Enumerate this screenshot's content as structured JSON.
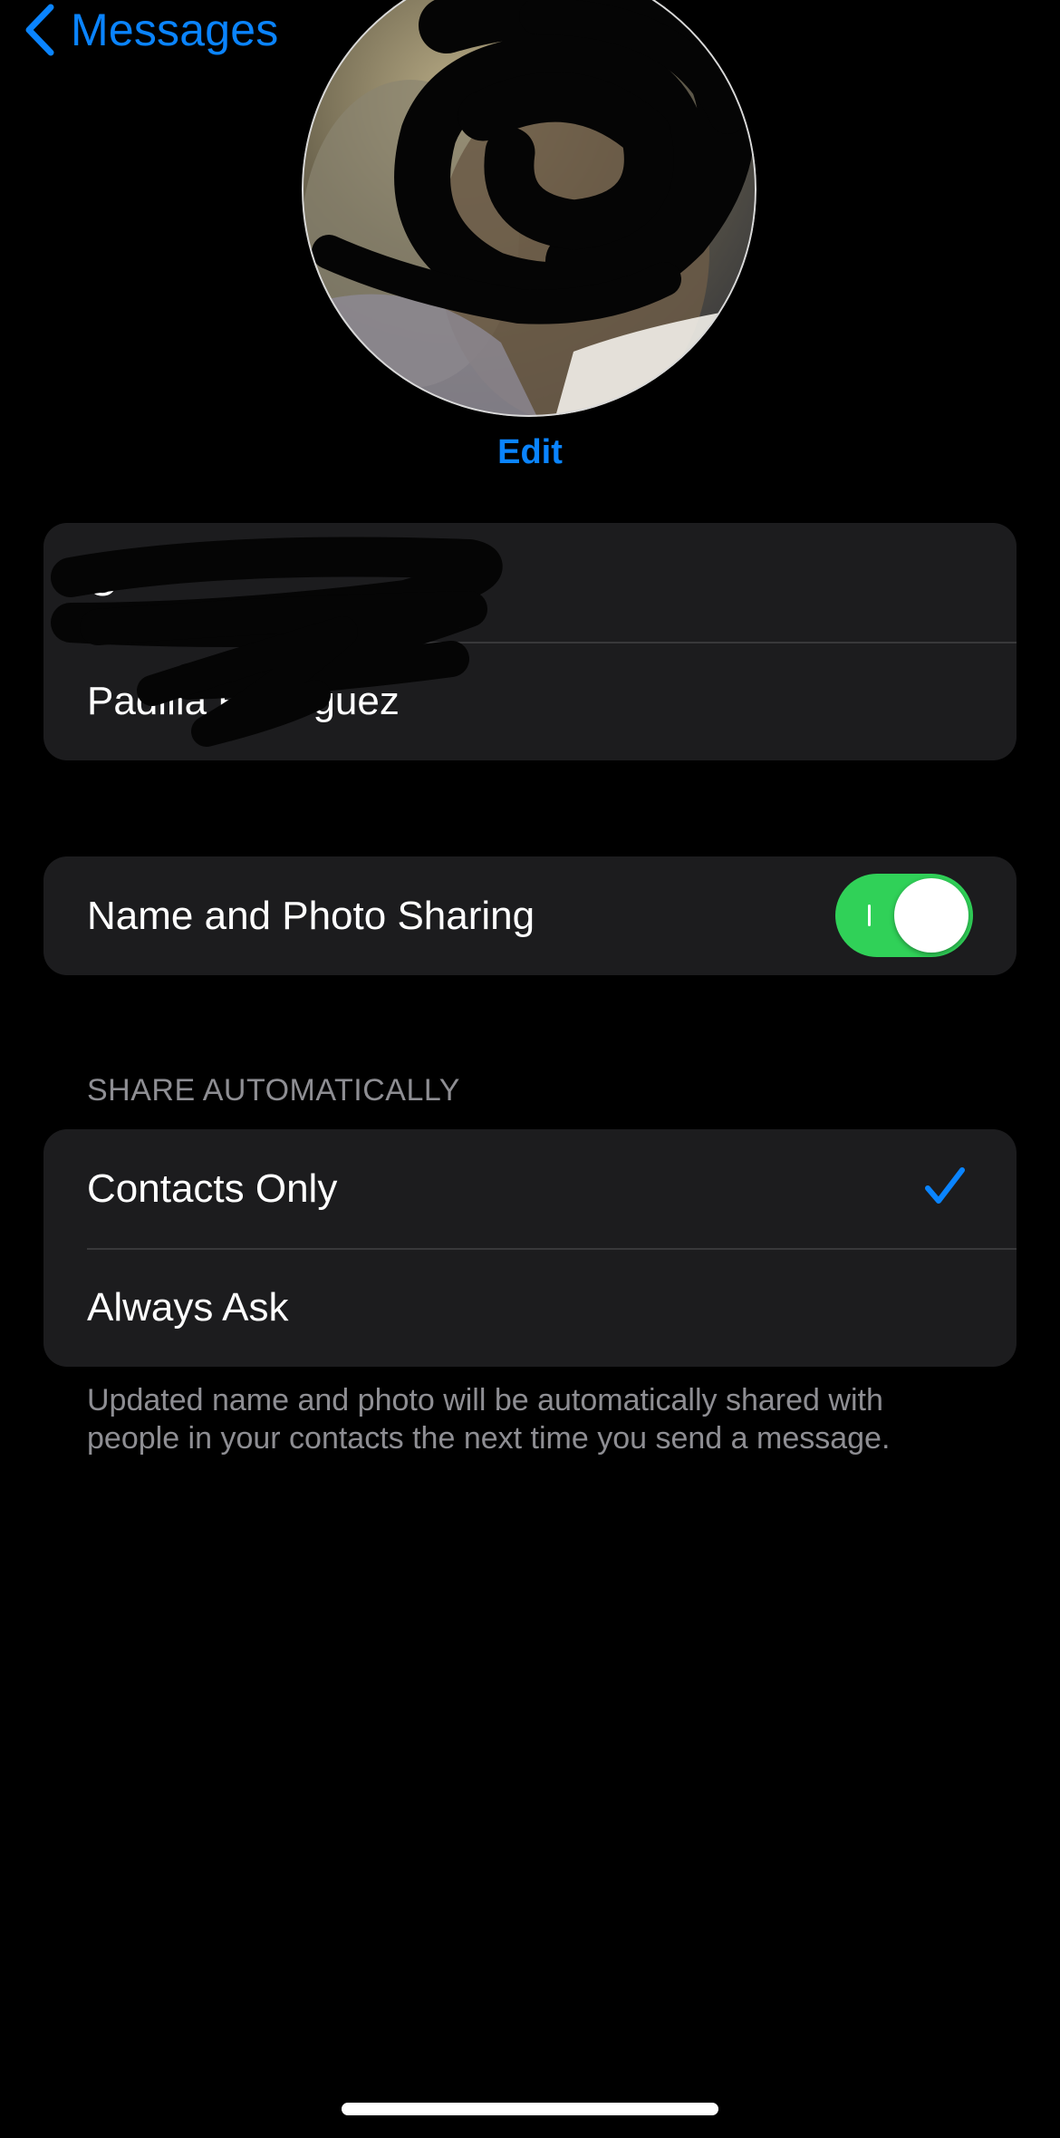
{
  "nav": {
    "back_label": "Messages"
  },
  "profile": {
    "edit_label": "Edit",
    "first_name": "O",
    "last_name": "Padilla Rodriguez"
  },
  "sharing": {
    "toggle_label": "Name and Photo Sharing",
    "toggle_on": true
  },
  "share_automatically": {
    "header": "SHARE AUTOMATICALLY",
    "options": [
      {
        "label": "Contacts Only",
        "selected": true
      },
      {
        "label": "Always Ask",
        "selected": false
      }
    ],
    "footer": "Updated name and photo will be automatically shared with people in your contacts the next time you send a message."
  },
  "icons": {
    "back": "chevron-left-icon",
    "check": "checkmark-icon"
  },
  "colors": {
    "accent": "#0a84ff",
    "toggle_on": "#30d158",
    "cell_bg": "#1c1c1e",
    "secondary_text": "#8e8e93"
  }
}
